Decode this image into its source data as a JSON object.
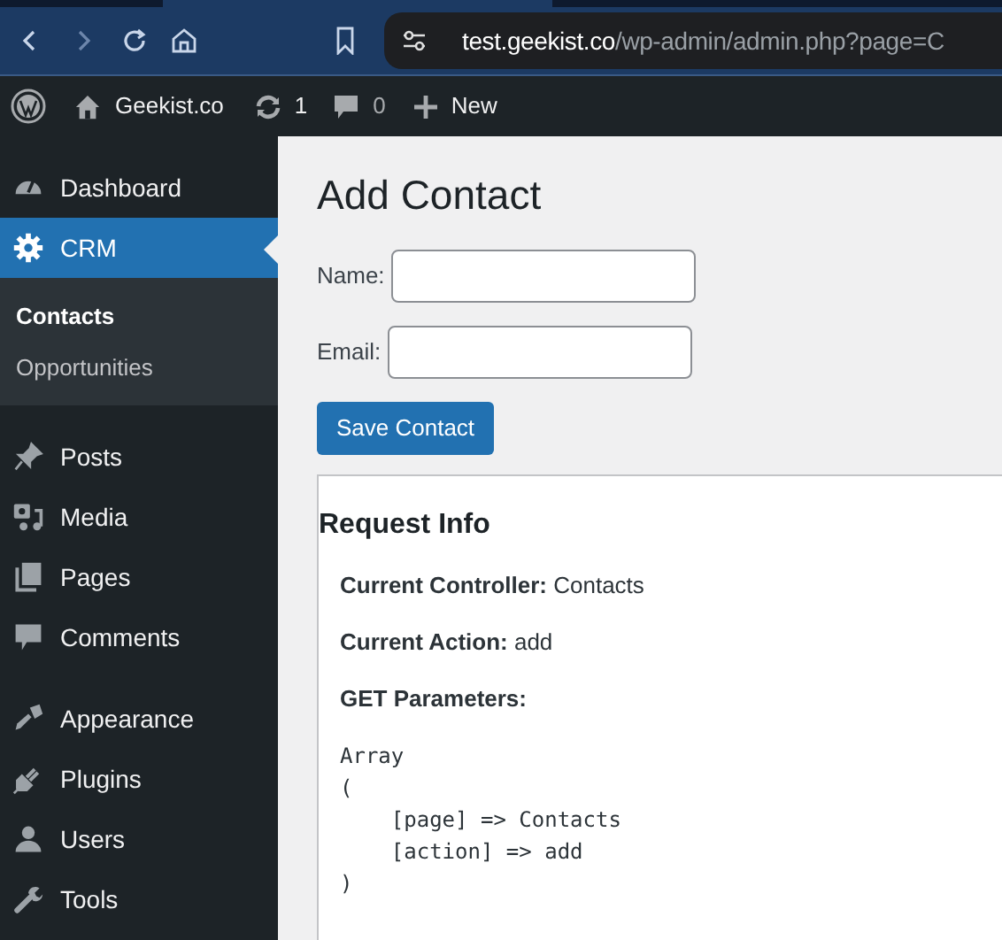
{
  "browser": {
    "url_host": "test.geekist.co",
    "url_path": "/wp-admin/admin.php?page=C"
  },
  "admin_bar": {
    "site_name": "Geekist.co",
    "updates_count": "1",
    "comments_count": "0",
    "new_label": "New"
  },
  "sidebar": {
    "sections": [
      {
        "items": [
          {
            "label": "Dashboard",
            "selected": false
          },
          {
            "label": "CRM",
            "selected": true,
            "children": [
              {
                "label": "Contacts",
                "selected": true
              },
              {
                "label": "Opportunities",
                "selected": false
              }
            ]
          }
        ]
      },
      {
        "items": [
          {
            "label": "Posts",
            "selected": false
          },
          {
            "label": "Media",
            "selected": false
          },
          {
            "label": "Pages",
            "selected": false
          },
          {
            "label": "Comments",
            "selected": false
          }
        ]
      },
      {
        "items": [
          {
            "label": "Appearance",
            "selected": false
          },
          {
            "label": "Plugins",
            "selected": false
          },
          {
            "label": "Users",
            "selected": false
          },
          {
            "label": "Tools",
            "selected": false
          }
        ]
      }
    ]
  },
  "page": {
    "title": "Add Contact",
    "fields": [
      {
        "label": "Name:"
      },
      {
        "label": "Email:"
      }
    ],
    "button": "Save Contact",
    "request_info": {
      "title": "Request Info",
      "lines": [
        {
          "label": "Current Controller:",
          "value": "Contacts"
        },
        {
          "label": "Current Action:",
          "value": "add"
        },
        {
          "label": "GET Parameters:"
        }
      ],
      "code": "Array\n(\n    [page] => Contacts\n    [action] => add\n)"
    }
  }
}
